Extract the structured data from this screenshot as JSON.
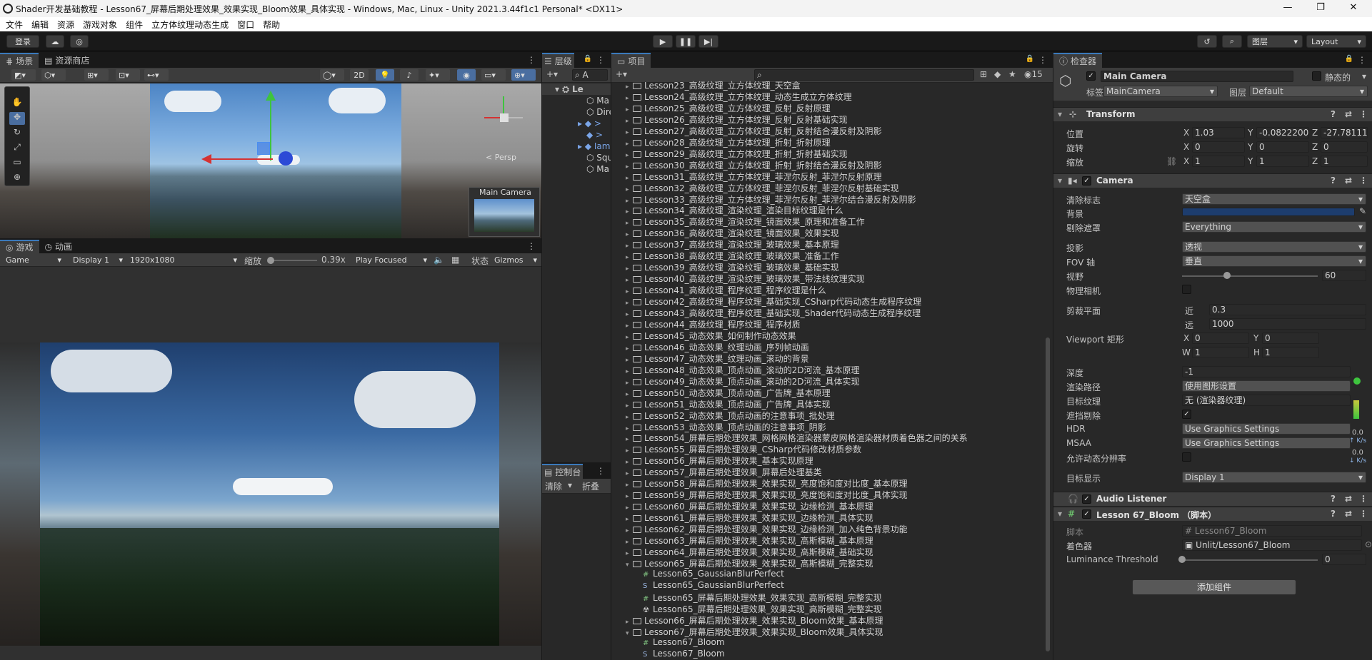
{
  "window": {
    "title": "Shader开发基础教程 - Lesson67_屏幕后期处理效果_效果实现_Bloom效果_具体实现 - Windows, Mac, Linux - Unity 2021.3.44f1c1 Personal* <DX11>",
    "minimize": "—",
    "maximize": "❐",
    "close": "✕"
  },
  "menu": [
    "文件",
    "编辑",
    "资源",
    "游戏对象",
    "组件",
    "立方体纹理动态生成",
    "窗口",
    "帮助"
  ],
  "toolbar": {
    "login": "登录",
    "layers": "图层",
    "layout": "Layout"
  },
  "scene": {
    "tab_scene": "场景",
    "tab_store": "资源商店",
    "mode_2d": "2D",
    "persp": "< Persp",
    "cam_preview_title": "Main Camera"
  },
  "game": {
    "tab_game": "游戏",
    "tab_anim": "动画",
    "display_mode": "Game",
    "display": "Display 1",
    "resolution": "1920x1080",
    "scale_label": "缩放",
    "scale_value": "0.39x",
    "play_focus": "Play Focused",
    "stats": "状态",
    "gizmos": "Gizmos",
    "scale_level": 0.05
  },
  "hierarchy": {
    "tab": "层级",
    "scene_name": "Le",
    "items": [
      "Ma",
      "Dire",
      ">",
      ">",
      "Iam",
      "Squ",
      "Ma"
    ]
  },
  "console": {
    "tab": "控制台",
    "clear": "清除",
    "collapse": "折叠"
  },
  "project": {
    "tab": "项目",
    "hidden_count": "15",
    "items": [
      {
        "t": "Lesson23_高级纹理_立方体纹理_天空盒",
        "k": "folder",
        "indent": 0
      },
      {
        "t": "Lesson24_高级纹理_立方体纹理_动态生成立方体纹理",
        "k": "folder",
        "indent": 0
      },
      {
        "t": "Lesson25_高级纹理_立方体纹理_反射_反射原理",
        "k": "folder",
        "indent": 0
      },
      {
        "t": "Lesson26_高级纹理_立方体纹理_反射_反射基础实现",
        "k": "folder",
        "indent": 0
      },
      {
        "t": "Lesson27_高级纹理_立方体纹理_反射_反射结合漫反射及阴影",
        "k": "folder",
        "indent": 0
      },
      {
        "t": "Lesson28_高级纹理_立方体纹理_折射_折射原理",
        "k": "folder",
        "indent": 0
      },
      {
        "t": "Lesson29_高级纹理_立方体纹理_折射_折射基础实现",
        "k": "folder",
        "indent": 0
      },
      {
        "t": "Lesson30_高级纹理_立方体纹理_折射_折射结合漫反射及阴影",
        "k": "folder",
        "indent": 0
      },
      {
        "t": "Lesson31_高级纹理_立方体纹理_菲涅尔反射_菲涅尔反射原理",
        "k": "folder",
        "indent": 0
      },
      {
        "t": "Lesson32_高级纹理_立方体纹理_菲涅尔反射_菲涅尔反射基础实现",
        "k": "folder",
        "indent": 0
      },
      {
        "t": "Lesson33_高级纹理_立方体纹理_菲涅尔反射_菲涅尔结合漫反射及阴影",
        "k": "folder",
        "indent": 0
      },
      {
        "t": "Lesson34_高级纹理_渲染纹理_渲染目标纹理是什么",
        "k": "folder",
        "indent": 0
      },
      {
        "t": "Lesson35_高级纹理_渲染纹理_镜面效果_原理和准备工作",
        "k": "folder",
        "indent": 0
      },
      {
        "t": "Lesson36_高级纹理_渲染纹理_镜面效果_效果实现",
        "k": "folder",
        "indent": 0
      },
      {
        "t": "Lesson37_高级纹理_渲染纹理_玻璃效果_基本原理",
        "k": "folder",
        "indent": 0
      },
      {
        "t": "Lesson38_高级纹理_渲染纹理_玻璃效果_准备工作",
        "k": "folder",
        "indent": 0
      },
      {
        "t": "Lesson39_高级纹理_渲染纹理_玻璃效果_基础实现",
        "k": "folder",
        "indent": 0
      },
      {
        "t": "Lesson40_高级纹理_渲染纹理_玻璃效果_带法线纹理实现",
        "k": "folder",
        "indent": 0
      },
      {
        "t": "Lesson41_高级纹理_程序纹理_程序纹理是什么",
        "k": "folder",
        "indent": 0
      },
      {
        "t": "Lesson42_高级纹理_程序纹理_基础实现_CSharp代码动态生成程序纹理",
        "k": "folder",
        "indent": 0
      },
      {
        "t": "Lesson43_高级纹理_程序纹理_基础实现_Shader代码动态生成程序纹理",
        "k": "folder",
        "indent": 0
      },
      {
        "t": "Lesson44_高级纹理_程序纹理_程序材质",
        "k": "folder",
        "indent": 0
      },
      {
        "t": "Lesson45_动态效果_如何制作动态效果",
        "k": "folder",
        "indent": 0
      },
      {
        "t": "Lesson46_动态效果_纹理动画_序列帧动画",
        "k": "folder",
        "indent": 0
      },
      {
        "t": "Lesson47_动态效果_纹理动画_滚动的背景",
        "k": "folder",
        "indent": 0
      },
      {
        "t": "Lesson48_动态效果_顶点动画_滚动的2D河流_基本原理",
        "k": "folder",
        "indent": 0
      },
      {
        "t": "Lesson49_动态效果_顶点动画_滚动的2D河流_具体实现",
        "k": "folder",
        "indent": 0
      },
      {
        "t": "Lesson50_动态效果_顶点动画_广告牌_基本原理",
        "k": "folder",
        "indent": 0
      },
      {
        "t": "Lesson51_动态效果_顶点动画_广告牌_具体实现",
        "k": "folder",
        "indent": 0
      },
      {
        "t": "Lesson52_动态效果_顶点动画的注意事项_批处理",
        "k": "folder",
        "indent": 0
      },
      {
        "t": "Lesson53_动态效果_顶点动画的注意事项_阴影",
        "k": "folder",
        "indent": 0
      },
      {
        "t": "Lesson54_屏幕后期处理效果_网格网格渲染器蒙皮网格渲染器材质着色器之间的关系",
        "k": "folder",
        "indent": 0
      },
      {
        "t": "Lesson55_屏幕后期处理效果_CSharp代码修改材质参数",
        "k": "folder",
        "indent": 0
      },
      {
        "t": "Lesson56_屏幕后期处理效果_基本实现原理",
        "k": "folder",
        "indent": 0
      },
      {
        "t": "Lesson57_屏幕后期处理效果_屏幕后处理基类",
        "k": "folder",
        "indent": 0
      },
      {
        "t": "Lesson58_屏幕后期处理效果_效果实现_亮度饱和度对比度_基本原理",
        "k": "folder",
        "indent": 0
      },
      {
        "t": "Lesson59_屏幕后期处理效果_效果实现_亮度饱和度对比度_具体实现",
        "k": "folder",
        "indent": 0
      },
      {
        "t": "Lesson60_屏幕后期处理效果_效果实现_边缘检测_基本原理",
        "k": "folder",
        "indent": 0
      },
      {
        "t": "Lesson61_屏幕后期处理效果_效果实现_边缘检测_具体实现",
        "k": "folder",
        "indent": 0
      },
      {
        "t": "Lesson62_屏幕后期处理效果_效果实现_边缘检测_加入纯色背景功能",
        "k": "folder",
        "indent": 0
      },
      {
        "t": "Lesson63_屏幕后期处理效果_效果实现_高斯模糊_基本原理",
        "k": "folder",
        "indent": 0
      },
      {
        "t": "Lesson64_屏幕后期处理效果_效果实现_高斯模糊_基础实现",
        "k": "folder",
        "indent": 0
      },
      {
        "t": "Lesson65_屏幕后期处理效果_效果实现_高斯模糊_完整实现",
        "k": "open",
        "indent": 0
      },
      {
        "t": "Lesson65_GaussianBlurPerfect",
        "k": "cs",
        "indent": 1
      },
      {
        "t": "Lesson65_GaussianBlurPerfect",
        "k": "shader",
        "indent": 1
      },
      {
        "t": "Lesson65_屏幕后期处理效果_效果实现_高斯模糊_完整实现",
        "k": "cs",
        "indent": 1
      },
      {
        "t": "Lesson65_屏幕后期处理效果_效果实现_高斯模糊_完整实现",
        "k": "scene",
        "indent": 1
      },
      {
        "t": "Lesson66_屏幕后期处理效果_效果实现_Bloom效果_基本原理",
        "k": "folder",
        "indent": 0
      },
      {
        "t": "Lesson67_屏幕后期处理效果_效果实现_Bloom效果_具体实现",
        "k": "open",
        "indent": 0
      },
      {
        "t": "Lesson67_Bloom",
        "k": "cs",
        "indent": 1
      },
      {
        "t": "Lesson67_Bloom",
        "k": "shader",
        "indent": 1
      }
    ]
  },
  "inspector": {
    "tab": "检查器",
    "object_name": "Main Camera",
    "static_label": "静态的",
    "tag_label": "标签",
    "tag_value": "MainCamera",
    "layer_label": "图层",
    "layer_value": "Default",
    "transform": {
      "title": "Transform",
      "position_label": "位置",
      "rotation_label": "旋转",
      "scale_label": "缩放",
      "pos": [
        "1.03",
        "-0.0822200",
        "-27.78111"
      ],
      "rot": [
        "0",
        "0",
        "0"
      ],
      "scl": [
        "1",
        "1",
        "1"
      ]
    },
    "camera": {
      "title": "Camera",
      "clear_flags_label": "清除标志",
      "clear_flags": "天空盒",
      "background_label": "背景",
      "background_color": "#1d3d6e",
      "culling_label": "剔除遮罩",
      "culling": "Everything",
      "projection_label": "投影",
      "projection": "透视",
      "fov_axis_label": "FOV 轴",
      "fov_axis": "垂直",
      "fov_label": "视野",
      "fov": "60",
      "fov_level": 0.33,
      "physical_label": "物理相机",
      "clip_label": "剪裁平面",
      "near_label": "近",
      "near": "0.3",
      "far_label": "远",
      "far": "1000",
      "viewport_label": "Viewport 矩形",
      "vp_x": "0",
      "vp_y": "0",
      "vp_w": "1",
      "vp_h": "1",
      "depth_label": "深度",
      "depth": "-1",
      "render_path_label": "渲染路径",
      "render_path": "使用图形设置",
      "target_tex_label": "目标纹理",
      "target_tex": "无 (渲染器纹理)",
      "occlusion_label": "遮挡剔除",
      "hdr_label": "HDR",
      "hdr": "Use Graphics Settings",
      "msaa_label": "MSAA",
      "msaa": "Use Graphics Settings",
      "dyn_res_label": "允许动态分辨率",
      "target_display_label": "目标显示",
      "target_display": "Display 1"
    },
    "audio_listener": "Audio Listener",
    "bloom": {
      "title": "Lesson 67_Bloom （脚本）",
      "script_label": "脚本",
      "script": "Lesson67_Bloom",
      "shader_label": "着色器",
      "shader": "Unlit/Lesson67_Bloom",
      "lum_label": "Luminance Threshold",
      "lum": "0",
      "lum_level": 0.0
    },
    "add_component": "添加组件",
    "side_stats": [
      "0.0",
      "↑ K/s",
      "0.0",
      "↓ K/s"
    ]
  }
}
